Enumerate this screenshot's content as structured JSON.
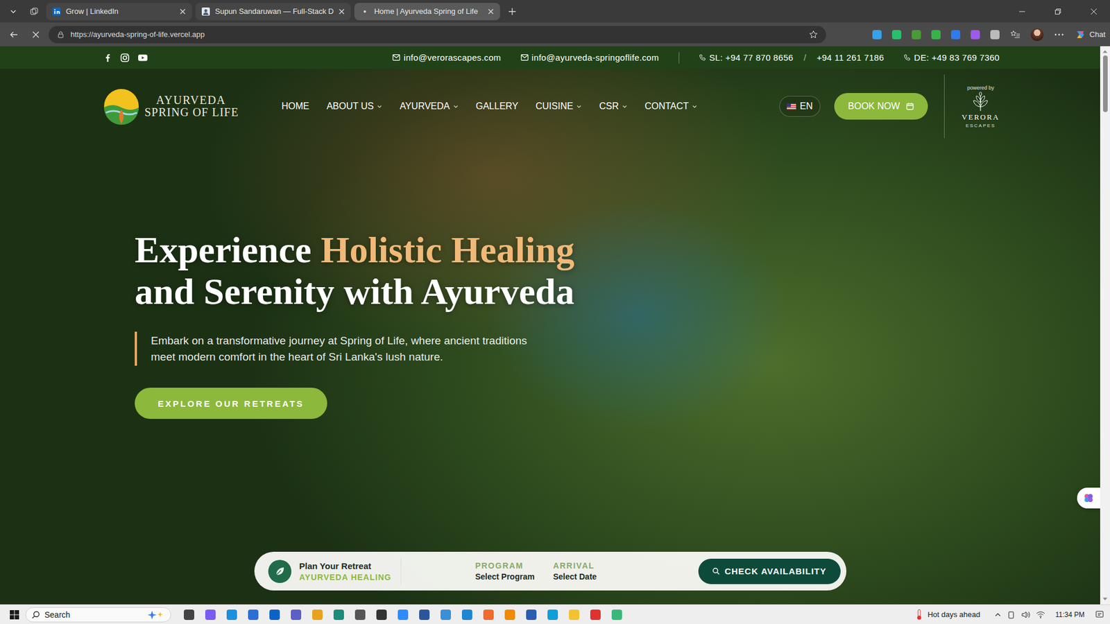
{
  "browser": {
    "tabs": [
      {
        "label": "Grow | LinkedIn",
        "selected": false
      },
      {
        "label": "Supun Sandaruwan — Full-Stack D",
        "selected": false
      },
      {
        "label": "Home | Ayurveda Spring of Life",
        "selected": true
      }
    ],
    "url": "https://ayurveda-spring-of-life.vercel.app",
    "loading": true,
    "chat_label": "Chat"
  },
  "site": {
    "contact_bar": {
      "emails": [
        "info@verorascapes.com",
        "info@ayurveda-springoflife.com"
      ],
      "phone_groups": [
        {
          "items": [
            "SL: +94 77 870 8656",
            "/",
            "+94 11 261 7186"
          ]
        },
        {
          "items": [
            "DE: +49 83 769 7360"
          ]
        }
      ]
    },
    "logo": {
      "line1": "AYURVEDA",
      "line2": "SPRING OF LIFE"
    },
    "nav": [
      {
        "label": "HOME",
        "dropdown": false
      },
      {
        "label": "ABOUT US",
        "dropdown": true
      },
      {
        "label": "AYURVEDA",
        "dropdown": true
      },
      {
        "label": "GALLERY",
        "dropdown": false
      },
      {
        "label": "CUISINE",
        "dropdown": true
      },
      {
        "label": "CSR",
        "dropdown": true
      },
      {
        "label": "CONTACT",
        "dropdown": true
      }
    ],
    "language": "EN",
    "book_button": "BOOK NOW",
    "partner": {
      "caption": "powered by",
      "name": "VERORA",
      "sub": "ESCAPES"
    },
    "hero": {
      "title_start": "Experience",
      "title_highlight": "Holistic Healing",
      "title_end": "and Serenity with Ayurveda",
      "text": "Embark on a transformative journey at Spring of Life, where ancient traditions meet modern comfort in the heart of Sri Lanka's lush nature.",
      "button": "EXPLORE OUR RETREATS"
    },
    "booking": {
      "title": "Plan Your Retreat",
      "subtitle": "AYURVEDA HEALING",
      "fields": [
        {
          "label": "PROGRAM",
          "value": "Select Program"
        },
        {
          "label": "ARRIVAL",
          "value": "Select Date"
        }
      ],
      "button": "CHECK AVAILABILITY"
    }
  },
  "taskbar": {
    "search": "Search",
    "weather": "Hot days ahead",
    "time": "11:34 PM"
  }
}
